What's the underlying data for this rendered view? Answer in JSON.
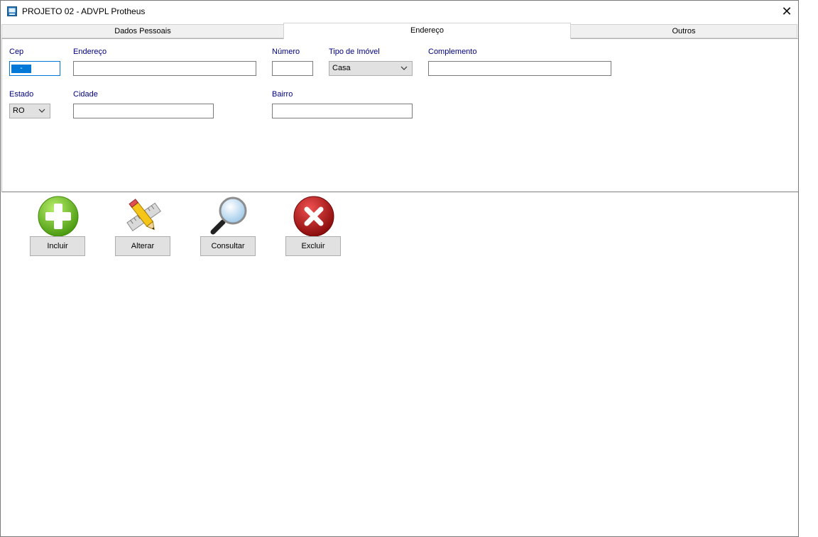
{
  "window": {
    "title": "PROJETO 02 - ADVPL Protheus",
    "close_glyph": "✕"
  },
  "tabs": [
    {
      "label": "Dados Pessoais",
      "active": false
    },
    {
      "label": "Endereço",
      "active": true
    },
    {
      "label": "Outros",
      "active": false
    }
  ],
  "form": {
    "cep": {
      "label": "Cep",
      "value": " - "
    },
    "endereco": {
      "label": "Endereço",
      "value": ""
    },
    "numero": {
      "label": "Número",
      "value": ""
    },
    "tipo_imovel": {
      "label": "Tipo de Imóvel",
      "value": "Casa"
    },
    "complemento": {
      "label": "Complemento",
      "value": ""
    },
    "estado": {
      "label": "Estado",
      "value": "RO"
    },
    "cidade": {
      "label": "Cidade",
      "value": ""
    },
    "bairro": {
      "label": "Bairro",
      "value": ""
    }
  },
  "toolbar": {
    "incluir": "Incluir",
    "alterar": "Alterar",
    "consultar": "Consultar",
    "excluir": "Excluir"
  },
  "colors": {
    "label_blue": "#000080",
    "selection": "#0078d7"
  }
}
